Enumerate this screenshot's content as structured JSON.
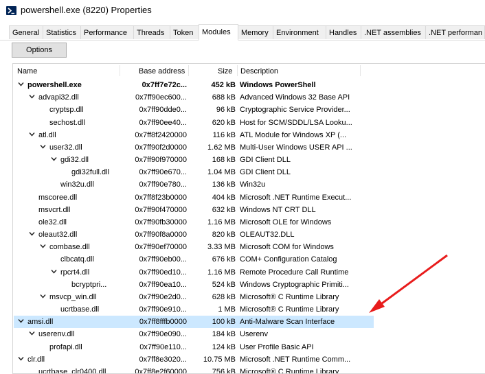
{
  "window": {
    "title": "powershell.exe (8220) Properties",
    "icon": "powershell-icon"
  },
  "tabs": [
    {
      "label": "General"
    },
    {
      "label": "Statistics"
    },
    {
      "label": "Performance"
    },
    {
      "label": "Threads"
    },
    {
      "label": "Token"
    },
    {
      "label": "Modules",
      "active": true
    },
    {
      "label": "Memory"
    },
    {
      "label": "Environment"
    },
    {
      "label": "Handles"
    },
    {
      "label": ".NET assemblies"
    },
    {
      "label": ".NET performan"
    }
  ],
  "toolbar": {
    "options_label": "Options"
  },
  "table": {
    "headers": {
      "name": "Name",
      "base": "Base address",
      "size": "Size",
      "desc": "Description"
    },
    "rows": [
      {
        "name": "powershell.exe",
        "base": "0x7ff7e72c...",
        "size": "452 kB",
        "desc": "Windows PowerShell",
        "depth": 0,
        "expander": true,
        "bold": true
      },
      {
        "name": "advapi32.dll",
        "base": "0x7ff90ec600...",
        "size": "688 kB",
        "desc": "Advanced Windows 32 Base API",
        "depth": 1,
        "expander": true
      },
      {
        "name": "cryptsp.dll",
        "base": "0x7ff90dde0...",
        "size": "96 kB",
        "desc": "Cryptographic Service Provider...",
        "depth": 2,
        "expander": false
      },
      {
        "name": "sechost.dll",
        "base": "0x7ff90ee40...",
        "size": "620 kB",
        "desc": "Host for SCM/SDDL/LSA Looku...",
        "depth": 2,
        "expander": false
      },
      {
        "name": "atl.dll",
        "base": "0x7ff8f2420000",
        "size": "116 kB",
        "desc": "ATL Module for Windows XP (...",
        "depth": 1,
        "expander": true
      },
      {
        "name": "user32.dll",
        "base": "0x7ff90f2d0000",
        "size": "1.62 MB",
        "desc": "Multi-User Windows USER API ...",
        "depth": 2,
        "expander": true
      },
      {
        "name": "gdi32.dll",
        "base": "0x7ff90f970000",
        "size": "168 kB",
        "desc": "GDI Client DLL",
        "depth": 3,
        "expander": true
      },
      {
        "name": "gdi32full.dll",
        "base": "0x7ff90e670...",
        "size": "1.04 MB",
        "desc": "GDI Client DLL",
        "depth": 4,
        "expander": false
      },
      {
        "name": "win32u.dll",
        "base": "0x7ff90e780...",
        "size": "136 kB",
        "desc": "Win32u",
        "depth": 3,
        "expander": false
      },
      {
        "name": "mscoree.dll",
        "base": "0x7ff8f23b0000",
        "size": "404 kB",
        "desc": "Microsoft .NET Runtime Execut...",
        "depth": 1,
        "expander": false
      },
      {
        "name": "msvcrt.dll",
        "base": "0x7ff90f470000",
        "size": "632 kB",
        "desc": "Windows NT CRT DLL",
        "depth": 1,
        "expander": false
      },
      {
        "name": "ole32.dll",
        "base": "0x7ff90fb30000",
        "size": "1.16 MB",
        "desc": "Microsoft OLE for Windows",
        "depth": 1,
        "expander": false
      },
      {
        "name": "oleaut32.dll",
        "base": "0x7ff90f8a0000",
        "size": "820 kB",
        "desc": "OLEAUT32.DLL",
        "depth": 1,
        "expander": true
      },
      {
        "name": "combase.dll",
        "base": "0x7ff90ef70000",
        "size": "3.33 MB",
        "desc": "Microsoft COM for Windows",
        "depth": 2,
        "expander": true
      },
      {
        "name": "clbcatq.dll",
        "base": "0x7ff90eb00...",
        "size": "676 kB",
        "desc": "COM+ Configuration Catalog",
        "depth": 3,
        "expander": false
      },
      {
        "name": "rpcrt4.dll",
        "base": "0x7ff90ed10...",
        "size": "1.16 MB",
        "desc": "Remote Procedure Call Runtime",
        "depth": 3,
        "expander": true
      },
      {
        "name": "bcryptpri...",
        "base": "0x7ff90ea10...",
        "size": "524 kB",
        "desc": "Windows Cryptographic Primiti...",
        "depth": 4,
        "expander": false
      },
      {
        "name": "msvcp_win.dll",
        "base": "0x7ff90e2d0...",
        "size": "628 kB",
        "desc": "Microsoft® C Runtime Library",
        "depth": 2,
        "expander": true
      },
      {
        "name": "ucrtbase.dll",
        "base": "0x7ff90e910...",
        "size": "1 MB",
        "desc": "Microsoft® C Runtime Library",
        "depth": 3,
        "expander": false
      },
      {
        "name": "amsi.dll",
        "base": "0x7ff8fffb0000",
        "size": "100 kB",
        "desc": "Anti-Malware Scan Interface",
        "depth": 0,
        "expander": true,
        "selected": true
      },
      {
        "name": "userenv.dll",
        "base": "0x7ff90e090...",
        "size": "184 kB",
        "desc": "Userenv",
        "depth": 1,
        "expander": true
      },
      {
        "name": "profapi.dll",
        "base": "0x7ff90e110...",
        "size": "124 kB",
        "desc": "User Profile Basic API",
        "depth": 2,
        "expander": false
      },
      {
        "name": "clr.dll",
        "base": "0x7ff8e3020...",
        "size": "10.75 MB",
        "desc": "Microsoft .NET Runtime Comm...",
        "depth": 0,
        "expander": true
      },
      {
        "name": "ucrtbase_clr0400.dll",
        "base": "0x7ff8e2f60000",
        "size": "756 kB",
        "desc": "Microsoft® C Runtime Library",
        "depth": 1,
        "expander": false
      }
    ]
  },
  "annotation": {
    "color": "#e81c1c"
  },
  "colors": {
    "selection": "#cce8ff"
  }
}
